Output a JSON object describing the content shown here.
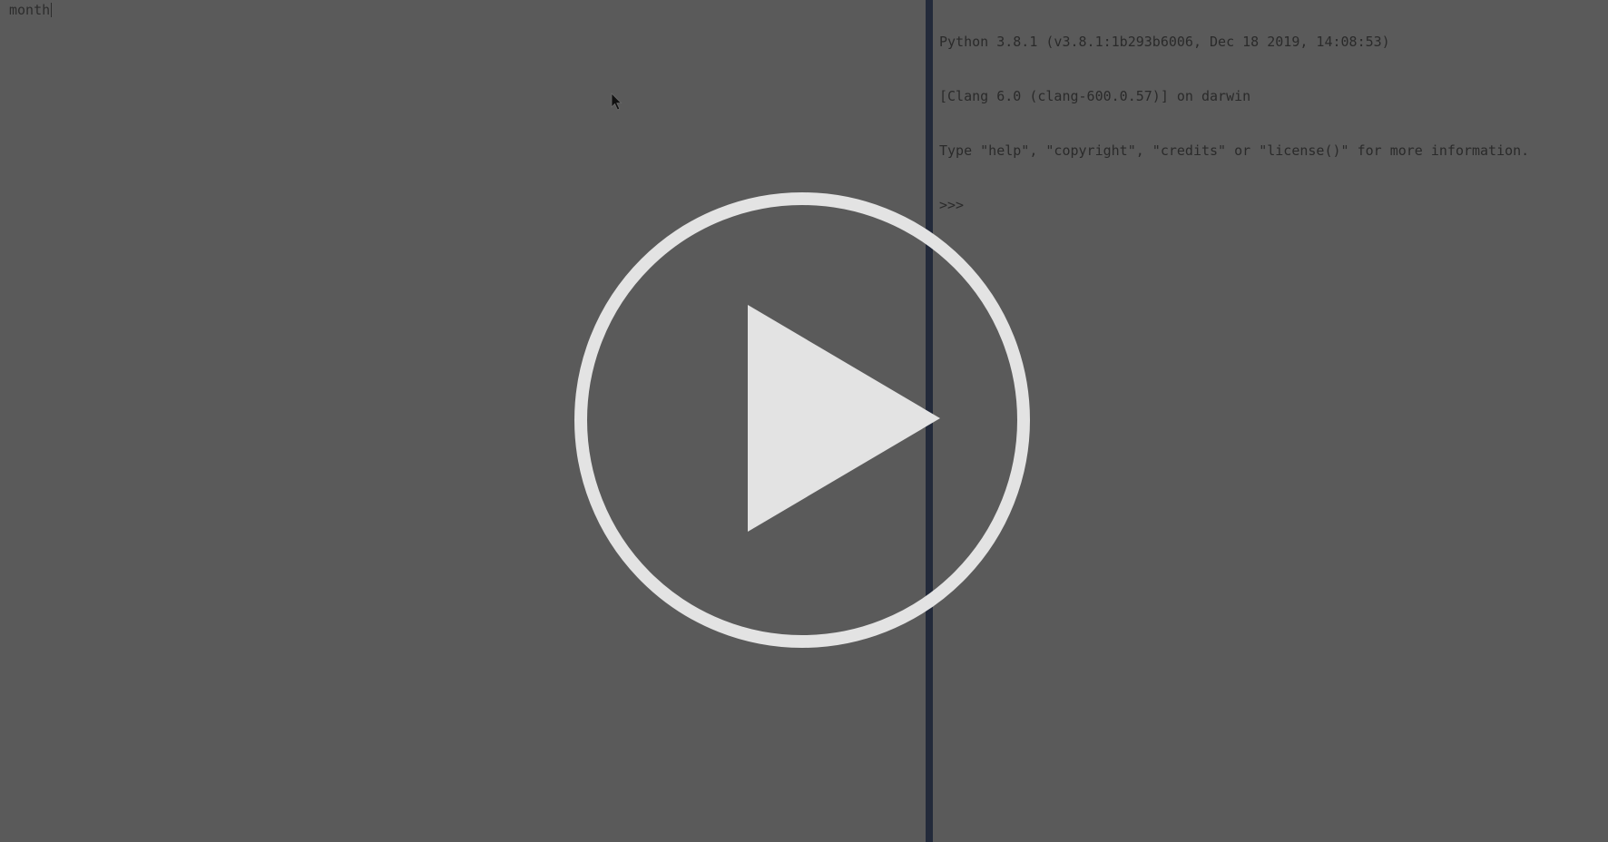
{
  "editor": {
    "text": "month"
  },
  "console": {
    "lines": [
      "Python 3.8.1 (v3.8.1:1b293b6006, Dec 18 2019, 14:08:53)",
      "[Clang 6.0 (clang-600.0.57)] on darwin",
      "Type \"help\", \"copyright\", \"credits\" or \"license()\" for more information.",
      ">>>"
    ]
  },
  "icons": {
    "pointer": "mouse-pointer-icon",
    "play": "play-button-icon"
  },
  "colors": {
    "background": "#5a5a5a",
    "divider": "#232a3a",
    "overlay": "#e3e3e3",
    "text": "#2a2a2a"
  }
}
